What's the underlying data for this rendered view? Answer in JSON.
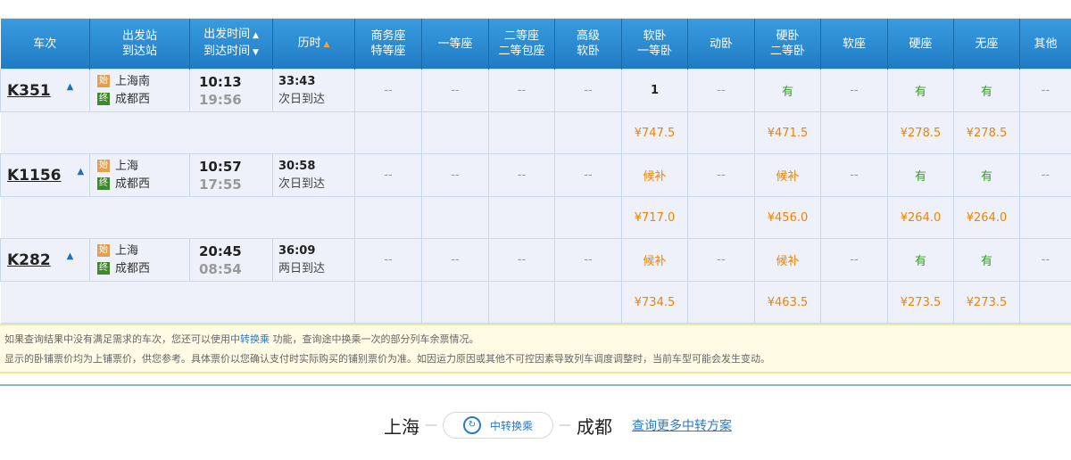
{
  "headers": [
    "车次",
    "出发站\n到达站",
    "出发时间\n到达时间",
    "历时",
    "商务座\n特等座",
    "一等座",
    "二等座\n二等包座",
    "高级\n软卧",
    "软卧\n一等卧",
    "动卧",
    "硬卧\n二等卧",
    "软座",
    "硬座",
    "无座",
    "其他"
  ],
  "header_lines": [
    [
      "车次"
    ],
    [
      "出发站",
      "到达站"
    ],
    [
      "出发时间",
      "到达时间"
    ],
    [
      "历时"
    ],
    [
      "商务座",
      "特等座"
    ],
    [
      "一等座"
    ],
    [
      "二等座",
      "二等包座"
    ],
    [
      "高级",
      "软卧"
    ],
    [
      "软卧",
      "一等卧"
    ],
    [
      "动卧"
    ],
    [
      "硬卧",
      "二等卧"
    ],
    [
      "软座"
    ],
    [
      "硬座"
    ],
    [
      "无座"
    ],
    [
      "其他"
    ]
  ],
  "badges": {
    "start": "始",
    "end": "终"
  },
  "trains": [
    {
      "code": "K351",
      "from": "上海南",
      "to": "成都西",
      "depart": "10:13",
      "arrive": "19:56",
      "duration": "33:43",
      "arrival_day": "次日到达",
      "seats": [
        "--",
        "--",
        "--",
        "--",
        "1",
        "--",
        "有",
        "--",
        "有",
        "有",
        "--"
      ],
      "prices": [
        "",
        "",
        "",
        "",
        "¥747.5",
        "",
        "¥471.5",
        "",
        "¥278.5",
        "¥278.5",
        ""
      ]
    },
    {
      "code": "K1156",
      "from": "上海",
      "to": "成都西",
      "depart": "10:57",
      "arrive": "17:55",
      "duration": "30:58",
      "arrival_day": "次日到达",
      "seats": [
        "--",
        "--",
        "--",
        "--",
        "候补",
        "--",
        "候补",
        "--",
        "有",
        "有",
        "--"
      ],
      "prices": [
        "",
        "",
        "",
        "",
        "¥717.0",
        "",
        "¥456.0",
        "",
        "¥264.0",
        "¥264.0",
        ""
      ]
    },
    {
      "code": "K282",
      "from": "上海",
      "to": "成都西",
      "depart": "20:45",
      "arrive": "08:54",
      "duration": "36:09",
      "arrival_day": "两日到达",
      "seats": [
        "--",
        "--",
        "--",
        "--",
        "候补",
        "--",
        "候补",
        "--",
        "有",
        "有",
        "--"
      ],
      "prices": [
        "",
        "",
        "",
        "",
        "¥734.5",
        "",
        "¥463.5",
        "",
        "¥273.5",
        "¥273.5",
        ""
      ]
    }
  ],
  "notice": {
    "line1_pre": "如果查询结果中没有满足需求的车次，您还可以使用",
    "line1_link": "中转换乘",
    "line1_post": " 功能，查询途中换乘一次的部分列车余票情况。",
    "line2": "显示的卧铺票价均为上铺票价，供您参考。具体票价以您确认支付时实际购买的铺别票价为准。如因运力原因或其他不可控因素导致列车调度调整时，当前车型可能会发生变动。"
  },
  "transfer": {
    "from": "上海",
    "button": "中转换乘",
    "to": "成都",
    "more": "查询更多中转方案"
  }
}
